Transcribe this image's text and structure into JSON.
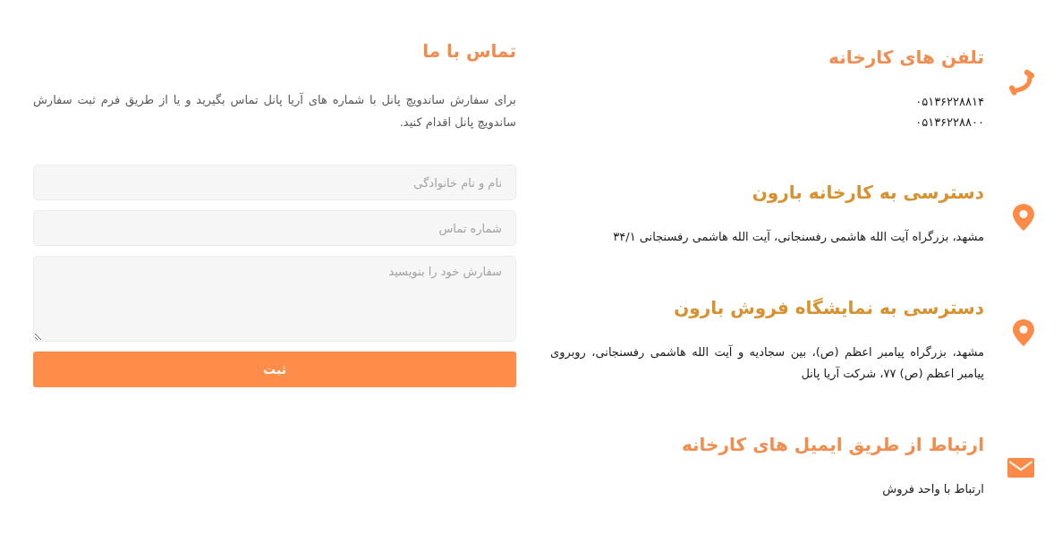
{
  "info_sections": [
    {
      "kind": "phone",
      "title": "تلفن های کارخانه",
      "color": "#f38d4f",
      "lines": [
        "۰۵۱۳۶۲۲۸۸۱۴",
        "۰۵۱۳۶۲۲۸۸۰۰"
      ]
    },
    {
      "kind": "location",
      "title": "دسترسی به کارخانه بارون",
      "color": "#d8912e",
      "lines": [
        "مشهد، بزرگراه آیت الله هاشمی رفسنجانی، آیت الله هاشمی رفسنجانی ۳۴/۱"
      ]
    },
    {
      "kind": "location",
      "title": "دسترسی به نمایشگاه فروش بارون",
      "color": "#d8912e",
      "lines": [
        "مشهد، بزرگراه پیامبر اعظم (ص)، بین سجادیه و آیت الله هاشمی رفسنجانی، روبروی پیامبر اعظم (ص) ۷۷، شرکت آریا پانل"
      ]
    },
    {
      "kind": "email",
      "title": "ارتباط از طریق ایمیل های کارخانه",
      "color": "#f38d4f",
      "lines": [
        "ارتباط با واحد فروش"
      ]
    }
  ],
  "contact_form": {
    "title": "تماس با ما",
    "description": "برای سفارش ساندویچ پانل با شماره های آریا پانل تماس بگیرید و یا از طریق فرم ثبت سفارش ساندویچ پانل اقدام کنید.",
    "fields": [
      {
        "kind": "input",
        "placeholder": "نام و نام خانوادگی"
      },
      {
        "kind": "input",
        "placeholder": "شماره تماس"
      },
      {
        "kind": "textarea",
        "placeholder": "سفارش خود را بنویسید"
      }
    ],
    "submit_button": "ثبت"
  }
}
